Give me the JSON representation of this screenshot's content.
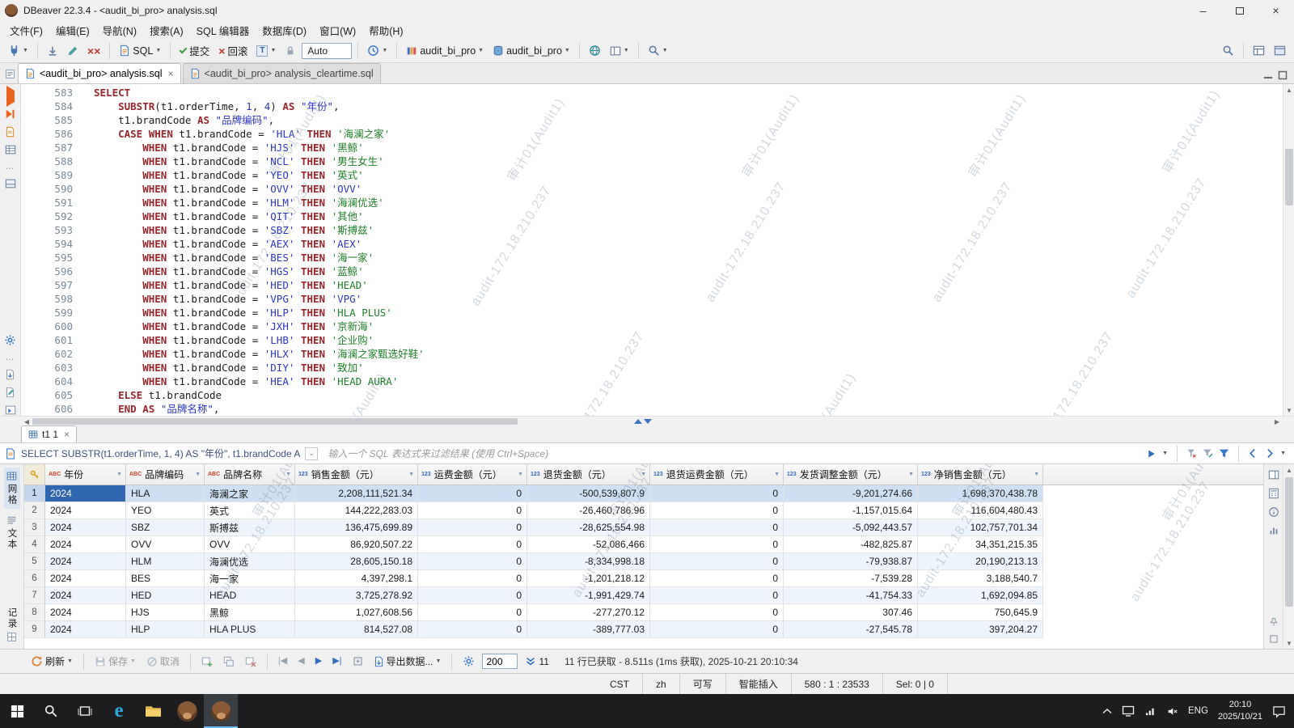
{
  "titlebar": {
    "title": "DBeaver 22.3.4 - <audit_bi_pro> analysis.sql"
  },
  "menubar": {
    "items": [
      "文件(F)",
      "编辑(E)",
      "导航(N)",
      "搜索(A)",
      "SQL 编辑器",
      "数据库(D)",
      "窗口(W)",
      "帮助(H)"
    ]
  },
  "toolbar": {
    "sql_label": "SQL",
    "commit": "提交",
    "rollback": "回滚",
    "auto": "Auto",
    "database": "audit_bi_pro",
    "schema": "audit_bi_pro"
  },
  "tabs": [
    {
      "label": "<audit_bi_pro> analysis.sql"
    },
    {
      "label": "<audit_bi_pro> analysis_cleartime.sql"
    }
  ],
  "watermark": {
    "host": "audit-172.18.210.237",
    "user": "审计01(Audit1)"
  },
  "editor": {
    "lines": [
      {
        "no": 583,
        "tk": [
          [
            "kw",
            "SELECT"
          ]
        ]
      },
      {
        "no": 584,
        "tk": [
          [
            "pl",
            "    "
          ],
          [
            "kw",
            "SUBSTR"
          ],
          [
            "pl",
            "("
          ],
          [
            "id",
            "t1.orderTime"
          ],
          [
            "pl",
            ", "
          ],
          [
            "nu",
            "1"
          ],
          [
            "pl",
            ", "
          ],
          [
            "nu",
            "4"
          ],
          [
            "pl",
            ") "
          ],
          [
            "kw",
            "AS"
          ],
          [
            "pl",
            " "
          ],
          [
            "qi",
            "\"年份\""
          ],
          [
            "pl",
            ","
          ]
        ]
      },
      {
        "no": 585,
        "tk": [
          [
            "pl",
            "    "
          ],
          [
            "id",
            "t1.brandCode"
          ],
          [
            "pl",
            " "
          ],
          [
            "kw",
            "AS"
          ],
          [
            "pl",
            " "
          ],
          [
            "qi",
            "\"品牌编码\""
          ],
          [
            "pl",
            ","
          ]
        ]
      },
      {
        "no": 586,
        "tk": [
          [
            "pl",
            "    "
          ],
          [
            "kw",
            "CASE"
          ],
          [
            "pl",
            " "
          ],
          [
            "kw",
            "WHEN"
          ],
          [
            "pl",
            " "
          ],
          [
            "id",
            "t1.brandCode"
          ],
          [
            "pl",
            " = "
          ],
          [
            "sb",
            "'HLA'"
          ],
          [
            "pl",
            " "
          ],
          [
            "kw",
            "THEN"
          ],
          [
            "pl",
            " "
          ],
          [
            "sg",
            "'海澜之家'"
          ]
        ]
      },
      {
        "no": 587,
        "tk": [
          [
            "pl",
            "        "
          ],
          [
            "kw",
            "WHEN"
          ],
          [
            "pl",
            " "
          ],
          [
            "id",
            "t1.brandCode"
          ],
          [
            "pl",
            " = "
          ],
          [
            "sb",
            "'HJS'"
          ],
          [
            "pl",
            " "
          ],
          [
            "kw",
            "THEN"
          ],
          [
            "pl",
            " "
          ],
          [
            "sg",
            "'黑鲸'"
          ]
        ]
      },
      {
        "no": 588,
        "tk": [
          [
            "pl",
            "        "
          ],
          [
            "kw",
            "WHEN"
          ],
          [
            "pl",
            " "
          ],
          [
            "id",
            "t1.brandCode"
          ],
          [
            "pl",
            " = "
          ],
          [
            "sb",
            "'NCL'"
          ],
          [
            "pl",
            " "
          ],
          [
            "kw",
            "THEN"
          ],
          [
            "pl",
            " "
          ],
          [
            "sg",
            "'男生女生'"
          ]
        ]
      },
      {
        "no": 589,
        "tk": [
          [
            "pl",
            "        "
          ],
          [
            "kw",
            "WHEN"
          ],
          [
            "pl",
            " "
          ],
          [
            "id",
            "t1.brandCode"
          ],
          [
            "pl",
            " = "
          ],
          [
            "sb",
            "'YEO'"
          ],
          [
            "pl",
            " "
          ],
          [
            "kw",
            "THEN"
          ],
          [
            "pl",
            " "
          ],
          [
            "sg",
            "'英式'"
          ]
        ]
      },
      {
        "no": 590,
        "tk": [
          [
            "pl",
            "        "
          ],
          [
            "kw",
            "WHEN"
          ],
          [
            "pl",
            " "
          ],
          [
            "id",
            "t1.brandCode"
          ],
          [
            "pl",
            " = "
          ],
          [
            "sb",
            "'OVV'"
          ],
          [
            "pl",
            " "
          ],
          [
            "kw",
            "THEN"
          ],
          [
            "pl",
            " "
          ],
          [
            "sb",
            "'OVV'"
          ]
        ]
      },
      {
        "no": 591,
        "tk": [
          [
            "pl",
            "        "
          ],
          [
            "kw",
            "WHEN"
          ],
          [
            "pl",
            " "
          ],
          [
            "id",
            "t1.brandCode"
          ],
          [
            "pl",
            " = "
          ],
          [
            "sb",
            "'HLM'"
          ],
          [
            "pl",
            " "
          ],
          [
            "kw",
            "THEN"
          ],
          [
            "pl",
            " "
          ],
          [
            "sg",
            "'海澜优选'"
          ]
        ]
      },
      {
        "no": 592,
        "tk": [
          [
            "pl",
            "        "
          ],
          [
            "kw",
            "WHEN"
          ],
          [
            "pl",
            " "
          ],
          [
            "id",
            "t1.brandCode"
          ],
          [
            "pl",
            " = "
          ],
          [
            "sb",
            "'QIT'"
          ],
          [
            "pl",
            " "
          ],
          [
            "kw",
            "THEN"
          ],
          [
            "pl",
            " "
          ],
          [
            "sg",
            "'其他'"
          ]
        ]
      },
      {
        "no": 593,
        "tk": [
          [
            "pl",
            "        "
          ],
          [
            "kw",
            "WHEN"
          ],
          [
            "pl",
            " "
          ],
          [
            "id",
            "t1.brandCode"
          ],
          [
            "pl",
            " = "
          ],
          [
            "sb",
            "'SBZ'"
          ],
          [
            "pl",
            " "
          ],
          [
            "kw",
            "THEN"
          ],
          [
            "pl",
            " "
          ],
          [
            "sg",
            "'斯搏兹'"
          ]
        ]
      },
      {
        "no": 594,
        "tk": [
          [
            "pl",
            "        "
          ],
          [
            "kw",
            "WHEN"
          ],
          [
            "pl",
            " "
          ],
          [
            "id",
            "t1.brandCode"
          ],
          [
            "pl",
            " = "
          ],
          [
            "sb",
            "'AEX'"
          ],
          [
            "pl",
            " "
          ],
          [
            "kw",
            "THEN"
          ],
          [
            "pl",
            " "
          ],
          [
            "sb",
            "'AEX'"
          ]
        ]
      },
      {
        "no": 595,
        "tk": [
          [
            "pl",
            "        "
          ],
          [
            "kw",
            "WHEN"
          ],
          [
            "pl",
            " "
          ],
          [
            "id",
            "t1.brandCode"
          ],
          [
            "pl",
            " = "
          ],
          [
            "sb",
            "'BES'"
          ],
          [
            "pl",
            " "
          ],
          [
            "kw",
            "THEN"
          ],
          [
            "pl",
            " "
          ],
          [
            "sg",
            "'海一家'"
          ]
        ]
      },
      {
        "no": 596,
        "tk": [
          [
            "pl",
            "        "
          ],
          [
            "kw",
            "WHEN"
          ],
          [
            "pl",
            " "
          ],
          [
            "id",
            "t1.brandCode"
          ],
          [
            "pl",
            " = "
          ],
          [
            "sb",
            "'HGS'"
          ],
          [
            "pl",
            " "
          ],
          [
            "kw",
            "THEN"
          ],
          [
            "pl",
            " "
          ],
          [
            "sg",
            "'蓝鲸'"
          ]
        ]
      },
      {
        "no": 597,
        "tk": [
          [
            "pl",
            "        "
          ],
          [
            "kw",
            "WHEN"
          ],
          [
            "pl",
            " "
          ],
          [
            "id",
            "t1.brandCode"
          ],
          [
            "pl",
            " = "
          ],
          [
            "sb",
            "'HED'"
          ],
          [
            "pl",
            " "
          ],
          [
            "kw",
            "THEN"
          ],
          [
            "pl",
            " "
          ],
          [
            "sg",
            "'HEAD'"
          ]
        ]
      },
      {
        "no": 598,
        "tk": [
          [
            "pl",
            "        "
          ],
          [
            "kw",
            "WHEN"
          ],
          [
            "pl",
            " "
          ],
          [
            "id",
            "t1.brandCode"
          ],
          [
            "pl",
            " = "
          ],
          [
            "sb",
            "'VPG'"
          ],
          [
            "pl",
            " "
          ],
          [
            "kw",
            "THEN"
          ],
          [
            "pl",
            " "
          ],
          [
            "sb",
            "'VPG'"
          ]
        ]
      },
      {
        "no": 599,
        "tk": [
          [
            "pl",
            "        "
          ],
          [
            "kw",
            "WHEN"
          ],
          [
            "pl",
            " "
          ],
          [
            "id",
            "t1.brandCode"
          ],
          [
            "pl",
            " = "
          ],
          [
            "sb",
            "'HLP'"
          ],
          [
            "pl",
            " "
          ],
          [
            "kw",
            "THEN"
          ],
          [
            "pl",
            " "
          ],
          [
            "sg",
            "'HLA PLUS'"
          ]
        ]
      },
      {
        "no": 600,
        "tk": [
          [
            "pl",
            "        "
          ],
          [
            "kw",
            "WHEN"
          ],
          [
            "pl",
            " "
          ],
          [
            "id",
            "t1.brandCode"
          ],
          [
            "pl",
            " = "
          ],
          [
            "sb",
            "'JXH'"
          ],
          [
            "pl",
            " "
          ],
          [
            "kw",
            "THEN"
          ],
          [
            "pl",
            " "
          ],
          [
            "sg",
            "'京新海'"
          ]
        ]
      },
      {
        "no": 601,
        "tk": [
          [
            "pl",
            "        "
          ],
          [
            "kw",
            "WHEN"
          ],
          [
            "pl",
            " "
          ],
          [
            "id",
            "t1.brandCode"
          ],
          [
            "pl",
            " = "
          ],
          [
            "sb",
            "'LHB'"
          ],
          [
            "pl",
            " "
          ],
          [
            "kw",
            "THEN"
          ],
          [
            "pl",
            " "
          ],
          [
            "sg",
            "'企业购'"
          ]
        ]
      },
      {
        "no": 602,
        "tk": [
          [
            "pl",
            "        "
          ],
          [
            "kw",
            "WHEN"
          ],
          [
            "pl",
            " "
          ],
          [
            "id",
            "t1.brandCode"
          ],
          [
            "pl",
            " = "
          ],
          [
            "sb",
            "'HLX'"
          ],
          [
            "pl",
            " "
          ],
          [
            "kw",
            "THEN"
          ],
          [
            "pl",
            " "
          ],
          [
            "sg",
            "'海澜之家甄选好鞋'"
          ]
        ]
      },
      {
        "no": 603,
        "tk": [
          [
            "pl",
            "        "
          ],
          [
            "kw",
            "WHEN"
          ],
          [
            "pl",
            " "
          ],
          [
            "id",
            "t1.brandCode"
          ],
          [
            "pl",
            " = "
          ],
          [
            "sb",
            "'DIY'"
          ],
          [
            "pl",
            " "
          ],
          [
            "kw",
            "THEN"
          ],
          [
            "pl",
            " "
          ],
          [
            "sg",
            "'致加'"
          ]
        ]
      },
      {
        "no": 604,
        "tk": [
          [
            "pl",
            "        "
          ],
          [
            "kw",
            "WHEN"
          ],
          [
            "pl",
            " "
          ],
          [
            "id",
            "t1.brandCode"
          ],
          [
            "pl",
            " = "
          ],
          [
            "sb",
            "'HEA'"
          ],
          [
            "pl",
            " "
          ],
          [
            "kw",
            "THEN"
          ],
          [
            "pl",
            " "
          ],
          [
            "sg",
            "'HEAD AURA'"
          ]
        ]
      },
      {
        "no": 605,
        "tk": [
          [
            "pl",
            "    "
          ],
          [
            "kw",
            "ELSE"
          ],
          [
            "pl",
            " "
          ],
          [
            "id",
            "t1.brandCode"
          ]
        ]
      },
      {
        "no": 606,
        "tk": [
          [
            "pl",
            "    "
          ],
          [
            "kw",
            "END"
          ],
          [
            "pl",
            " "
          ],
          [
            "kw",
            "AS"
          ],
          [
            "pl",
            " "
          ],
          [
            "qi",
            "\"品牌名称\""
          ],
          [
            "pl",
            ","
          ]
        ]
      }
    ]
  },
  "results": {
    "tab": "t1 1",
    "query_preview": "SELECT SUBSTR(t1.orderTime, 1, 4) AS \"年份\", t1.brandCode A",
    "filter_placeholder": "输入一个 SQL 表达式来过滤结果 (使用 Ctrl+Space)",
    "side": {
      "grid": "网格",
      "text": "文本",
      "record": "记录"
    },
    "columns": [
      {
        "type": "abc",
        "label": "年份"
      },
      {
        "type": "abc",
        "label": "品牌编码"
      },
      {
        "type": "abc",
        "label": "品牌名称"
      },
      {
        "type": "123",
        "label": "销售金额（元）"
      },
      {
        "type": "123",
        "label": "运费金额（元）"
      },
      {
        "type": "123",
        "label": "退货金额（元）"
      },
      {
        "type": "123",
        "label": "退货运费金额（元）"
      },
      {
        "type": "123",
        "label": "发货调整金额（元）"
      },
      {
        "type": "123",
        "label": "净销售金额（元）"
      }
    ],
    "rows": [
      [
        "2024",
        "HLA",
        "海澜之家",
        "2,208,111,521.34",
        "0",
        "-500,539,807.9",
        "0",
        "-9,201,274.66",
        "1,698,370,438.78"
      ],
      [
        "2024",
        "YEO",
        "英式",
        "144,222,283.03",
        "0",
        "-26,460,786.96",
        "0",
        "-1,157,015.64",
        "116,604,480.43"
      ],
      [
        "2024",
        "SBZ",
        "斯搏兹",
        "136,475,699.89",
        "0",
        "-28,625,554.98",
        "0",
        "-5,092,443.57",
        "102,757,701.34"
      ],
      [
        "2024",
        "OVV",
        "OVV",
        "86,920,507.22",
        "0",
        "-52,086,466",
        "0",
        "-482,825.87",
        "34,351,215.35"
      ],
      [
        "2024",
        "HLM",
        "海澜优选",
        "28,605,150.18",
        "0",
        "-8,334,998.18",
        "0",
        "-79,938.87",
        "20,190,213.13"
      ],
      [
        "2024",
        "BES",
        "海一家",
        "4,397,298.1",
        "0",
        "-1,201,218.12",
        "0",
        "-7,539.28",
        "3,188,540.7"
      ],
      [
        "2024",
        "HED",
        "HEAD",
        "3,725,278.92",
        "0",
        "-1,991,429.74",
        "0",
        "-41,754.33",
        "1,692,094.85"
      ],
      [
        "2024",
        "HJS",
        "黑鲸",
        "1,027,608.56",
        "0",
        "-277,270.12",
        "0",
        "307.46",
        "750,645.9"
      ],
      [
        "2024",
        "HLP",
        "HLA PLUS",
        "814,527.08",
        "0",
        "-389,777.03",
        "0",
        "-27,545.78",
        "397,204.27"
      ]
    ],
    "toolbar": {
      "refresh": "刷新",
      "save": "保存",
      "cancel": "取消",
      "export": "导出数据...",
      "fetch_size": "200",
      "count": "11",
      "status": "11 行已获取 - 8.511s (1ms 获取), 2025-10-21 20:10:34"
    }
  },
  "statusbar": {
    "cells": [
      "CST",
      "zh",
      "可写",
      "智能插入",
      "580 : 1 : 23533",
      "Sel: 0 | 0"
    ]
  },
  "taskbar": {
    "lang": "ENG",
    "time": "20:10",
    "date": "2025/10/21"
  }
}
